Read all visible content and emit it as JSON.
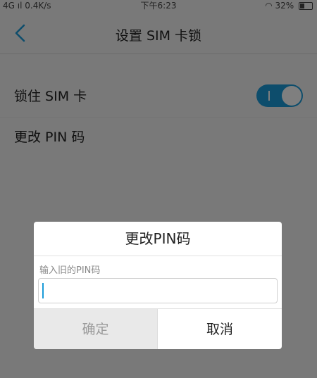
{
  "status_bar": {
    "network": "4G",
    "speed": "0.4K/s",
    "time": "下午6:23",
    "battery": "32%"
  },
  "header": {
    "title": "设置 SIM 卡锁",
    "back_icon": "chevron-left-icon"
  },
  "settings": {
    "items": [
      {
        "label": "锁住 SIM 卡",
        "toggle": "on"
      },
      {
        "label": "更改 PIN 码"
      }
    ]
  },
  "dialog": {
    "title": "更改PIN码",
    "hint": "输入旧的PIN码",
    "input_value": "",
    "ok_label": "确定",
    "cancel_label": "取消"
  },
  "colors": {
    "accent": "#1a9bd8",
    "overlay": "rgba(0,0,0,0.5)"
  }
}
